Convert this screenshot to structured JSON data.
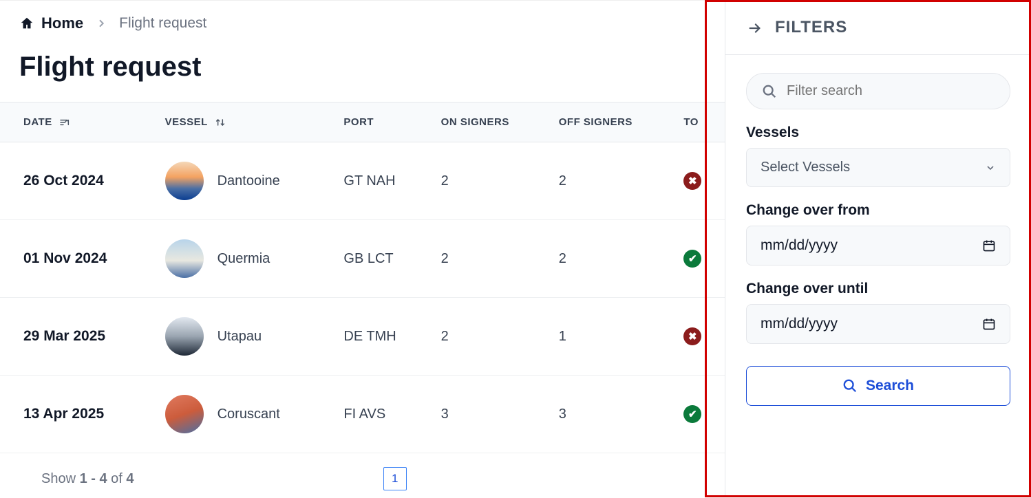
{
  "breadcrumb": {
    "home": "Home",
    "current": "Flight request"
  },
  "page_title": "Flight request",
  "columns": {
    "date": "DATE",
    "vessel": "VESSEL",
    "port": "PORT",
    "on_signers": "ON SIGNERS",
    "off_signers": "OFF SIGNERS",
    "to": "TO"
  },
  "rows": [
    {
      "date": "26 Oct 2024",
      "vessel": "Dantooine",
      "port": "GT NAH",
      "on": "2",
      "off": "2",
      "status": "bad"
    },
    {
      "date": "01 Nov 2024",
      "vessel": "Quermia",
      "port": "GB LCT",
      "on": "2",
      "off": "2",
      "status": "ok"
    },
    {
      "date": "29 Mar 2025",
      "vessel": "Utapau",
      "port": "DE TMH",
      "on": "2",
      "off": "1",
      "status": "bad"
    },
    {
      "date": "13 Apr 2025",
      "vessel": "Coruscant",
      "port": "FI AVS",
      "on": "3",
      "off": "3",
      "status": "ok"
    }
  ],
  "pager": {
    "show_prefix": "Show ",
    "range": "1 - 4",
    "of": " of ",
    "total": "4",
    "page": "1"
  },
  "filters": {
    "title": "FILTERS",
    "search_placeholder": "Filter search",
    "vessels_label": "Vessels",
    "vessels_select": "Select Vessels",
    "from_label": "Change over from",
    "until_label": "Change over until",
    "date_placeholder": "mm/dd/yyyy",
    "search_button": "Search"
  }
}
